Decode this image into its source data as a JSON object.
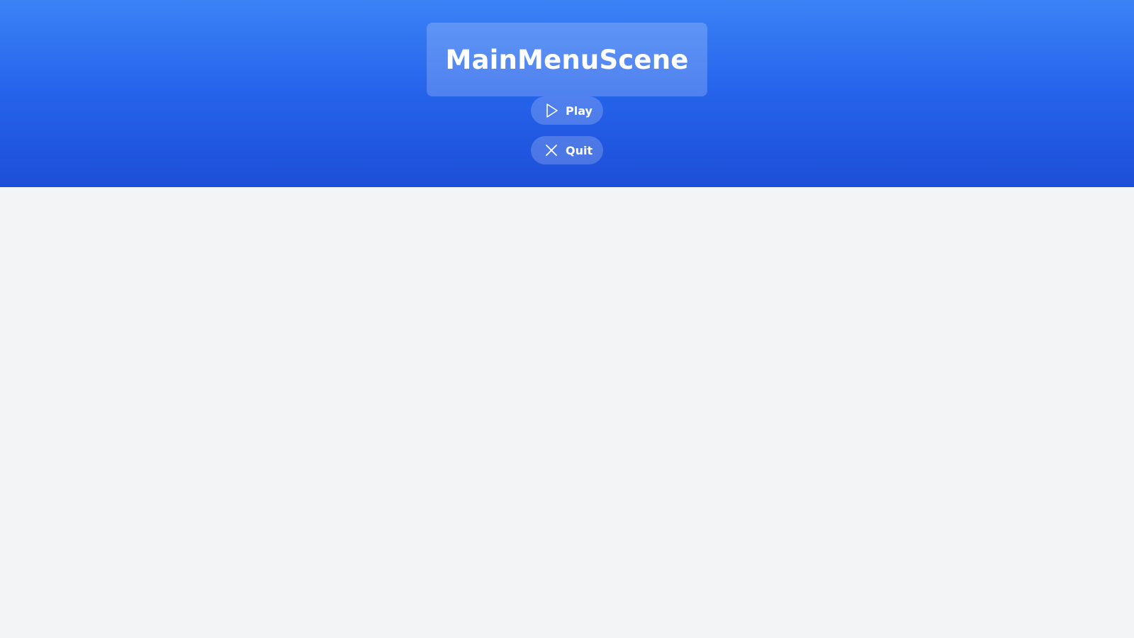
{
  "scene": {
    "title": "MainMenuScene"
  },
  "menu": {
    "buttons": [
      {
        "label": "Play",
        "icon": "play-icon"
      },
      {
        "label": "Quit",
        "icon": "close-icon"
      }
    ]
  },
  "colors": {
    "header_top": "#3b82f6",
    "header_bottom": "#1d4ed8",
    "page_background": "#f3f4f6",
    "text": "#ffffff"
  }
}
